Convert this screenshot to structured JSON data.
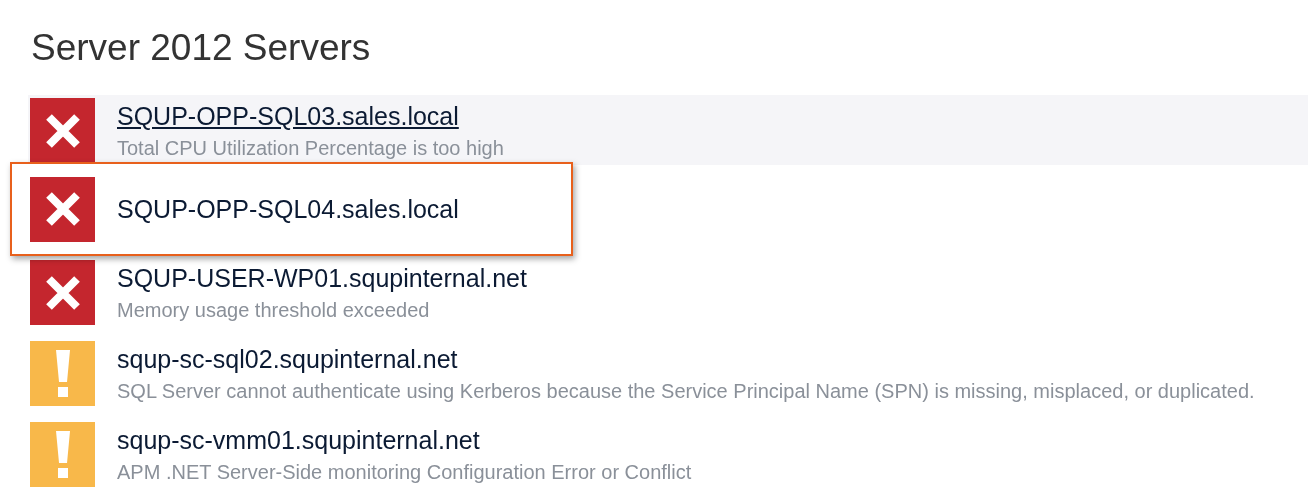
{
  "title": "Server 2012 Servers",
  "servers": [
    {
      "kind": "error",
      "name": "SQUP-OPP-SQL03.sales.local",
      "description": "Total CPU Utilization Percentage is too high",
      "hovered": true,
      "highlighted": false
    },
    {
      "kind": "error",
      "name": "SQUP-OPP-SQL04.sales.local",
      "hovered": false,
      "highlighted": true
    },
    {
      "kind": "error",
      "name": "SQUP-USER-WP01.squpinternal.net",
      "description": "Memory usage threshold exceeded",
      "hovered": false,
      "highlighted": false
    },
    {
      "kind": "warning",
      "name": "squp-sc-sql02.squpinternal.net",
      "description": "SQL Server cannot authenticate using Kerberos because the Service Principal Name (SPN) is missing, misplaced, or duplicated.",
      "hovered": false,
      "highlighted": false
    },
    {
      "kind": "warning",
      "name": "squp-sc-vmm01.squpinternal.net",
      "description": "APM .NET Server-Side monitoring Configuration Error or Conflict",
      "hovered": false,
      "highlighted": false
    }
  ]
}
